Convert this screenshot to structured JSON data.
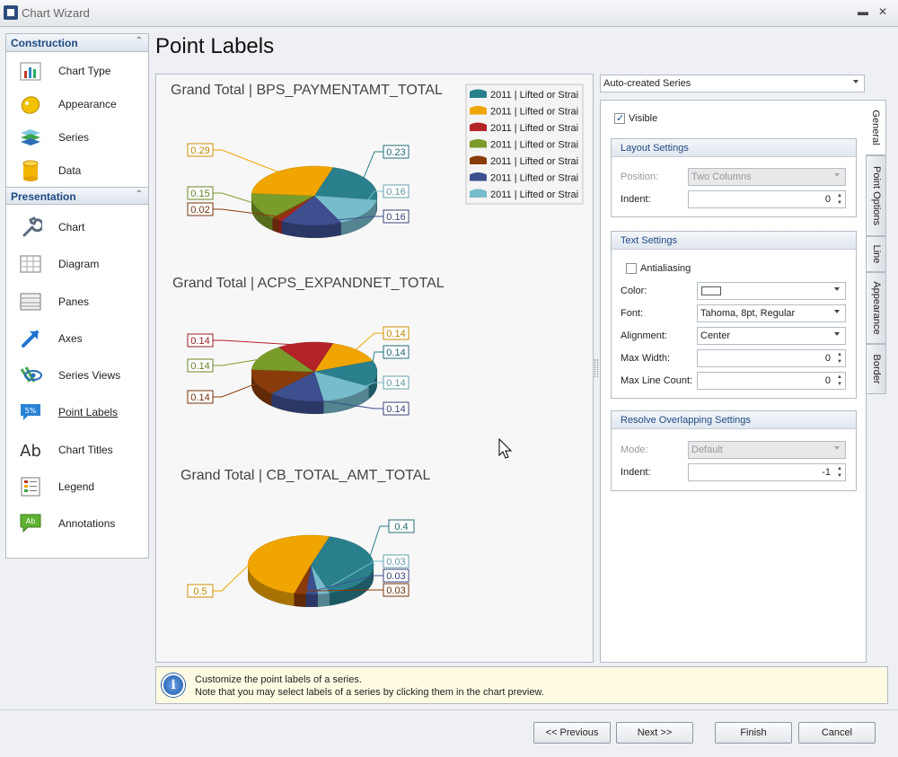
{
  "window": {
    "title": "Chart Wizard"
  },
  "sidebar": {
    "construction": {
      "title": "Construction",
      "items": [
        {
          "label": "Chart Type",
          "icon": "chart-type-icon"
        },
        {
          "label": "Appearance",
          "icon": "appearance-icon"
        },
        {
          "label": "Series",
          "icon": "series-icon"
        },
        {
          "label": "Data",
          "icon": "data-icon"
        }
      ]
    },
    "presentation": {
      "title": "Presentation",
      "items": [
        {
          "label": "Chart",
          "icon": "wrench-icon"
        },
        {
          "label": "Diagram",
          "icon": "diagram-icon"
        },
        {
          "label": "Panes",
          "icon": "panes-icon"
        },
        {
          "label": "Axes",
          "icon": "axes-icon"
        },
        {
          "label": "Series Views",
          "icon": "series-views-icon"
        },
        {
          "label": "Point Labels",
          "icon": "point-labels-icon",
          "active": true
        },
        {
          "label": "Chart Titles",
          "icon": "chart-titles-icon"
        },
        {
          "label": "Legend",
          "icon": "legend-icon"
        },
        {
          "label": "Annotations",
          "icon": "annotations-icon"
        }
      ]
    }
  },
  "page": {
    "title": "Point Labels"
  },
  "chart_data": {
    "type": "pie",
    "legend": {
      "placement": "top-right",
      "entries": [
        "2011 | Lifted or Strai",
        "2011 | Lifted or Strai",
        "2011 | Lifted or Strai",
        "2011 | Lifted or Strai",
        "2011 | Lifted or Strai",
        "2011 | Lifted or Strai",
        "2011 | Lifted or Strai"
      ]
    },
    "charts": [
      {
        "title": "Grand Total | BPS_PAYMENTAMT_TOTAL",
        "values": [
          0.23,
          0.16,
          0.16,
          0.01,
          0.02,
          0.15,
          0.29
        ],
        "labels": [
          "0.23",
          "0.16",
          "0.16",
          "",
          "0.02",
          "0.15",
          "0.29"
        ]
      },
      {
        "title": "Grand Total | ACPS_EXPANDNET_TOTAL",
        "values": [
          0.14,
          0.14,
          0.14,
          0.14,
          0.14,
          0.14,
          0.14
        ],
        "labels": [
          "0.14",
          "0.14",
          "0.14",
          "0.14",
          "0.14",
          "0.14",
          "0.14"
        ]
      },
      {
        "title": "Grand Total | CB_TOTAL_AMT_TOTAL",
        "values": [
          0.4,
          0.03,
          0.03,
          0.03,
          0.5
        ],
        "labels": [
          "0.4",
          "0.03",
          "0.03",
          "0.03",
          "0.5"
        ]
      }
    ]
  },
  "colors": {
    "s0": "#2a7f8c",
    "s1": "#f0a500",
    "s2": "#b32327",
    "s3": "#7a9c2a",
    "s4": "#8a3b0a",
    "s5": "#3d4f8f",
    "s6": "#77bccc"
  },
  "series_combo": {
    "value": "Auto-created Series"
  },
  "tabs": [
    "General",
    "Point Options",
    "Line",
    "Appearance",
    "Border"
  ],
  "general": {
    "visible_label": "Visible",
    "visible_checked": true,
    "layout": {
      "title": "Layout Settings",
      "position_label": "Position:",
      "position_value": "Two Columns",
      "indent_label": "Indent:",
      "indent_value": "0"
    },
    "text": {
      "title": "Text Settings",
      "antialiasing_label": "Antialiasing",
      "antialiasing_checked": false,
      "color_label": "Color:",
      "font_label": "Font:",
      "font_value": "Tahoma, 8pt, Regular",
      "alignment_label": "Alignment:",
      "alignment_value": "Center",
      "maxwidth_label": "Max Width:",
      "maxwidth_value": "0",
      "maxlines_label": "Max Line Count:",
      "maxlines_value": "0"
    },
    "overlap": {
      "title": "Resolve Overlapping Settings",
      "mode_label": "Mode:",
      "mode_value": "Default",
      "indent_label": "Indent:",
      "indent_value": "-1"
    }
  },
  "hint": {
    "line1": "Customize the point labels of a series.",
    "line2": "Note that you may select labels of a series by clicking them in the chart preview."
  },
  "buttons": {
    "previous": "<< Previous",
    "next": "Next >>",
    "finish": "Finish",
    "cancel": "Cancel"
  }
}
